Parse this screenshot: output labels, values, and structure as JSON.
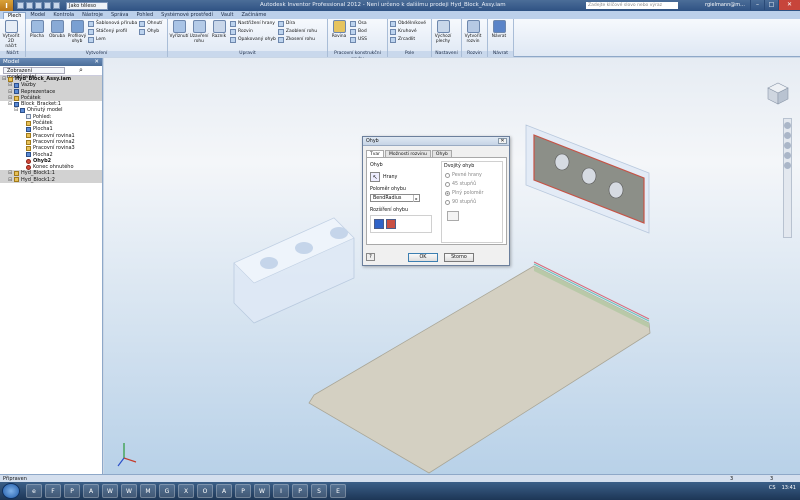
{
  "titlebar": {
    "qat_select": "Jako těleso",
    "title": "Autodesk Inventor Professional 2012 - Není určeno k dalšímu prodeji    Hyd_Block_Assy.iam",
    "search_placeholder": "Zadejte klíčové slovo nebo výraz",
    "user": "rgielmann@m..."
  },
  "tabs": [
    "Plech",
    "Model",
    "Kontrola",
    "Nástroje",
    "Správa",
    "Pohled",
    "Systémové prostředí",
    "Vault",
    "Začínáme"
  ],
  "ribbon": {
    "nacrt": {
      "label": "Náčrt",
      "btn": "Vytvořit 2D náčrt"
    },
    "vytvoreni": {
      "label": "Vytvoření",
      "big": [
        "Plocha",
        "Obruba",
        "Profilový ohyb"
      ],
      "small": [
        "Šablonová příruba",
        "Stáčený profil",
        "Lem",
        "Ohyb",
        "Ohnutí"
      ]
    },
    "upravit": {
      "label": "Upravit",
      "big": [
        "Vyříznutí",
        "Uzavření rohu",
        "Razník"
      ],
      "small": [
        "Nastřižení hrany",
        "Rozvin",
        "Opakovaný ohyb",
        "Díra",
        "Zaoblení rohu",
        "Zkosení rohu"
      ]
    },
    "pracovni": {
      "label": "Pracovní konstrukční prvky",
      "big": [
        "Rovina"
      ],
      "small": [
        "Osa",
        "Bod",
        "USS"
      ]
    },
    "pole": {
      "label": "Pole",
      "small": [
        "Obdélníkové",
        "Kruhové",
        "Zrcadlit"
      ]
    },
    "nastaveni": {
      "label": "Nastavení",
      "btn": "Výchozí plechy"
    },
    "rozvin": {
      "label": "Rozvin",
      "btn": "Vytvořit rozvin"
    },
    "navrat": {
      "label": "Návrat",
      "btn": "Návrat"
    }
  },
  "browser": {
    "title": "Model",
    "dropdown": "Zobrazení modelování",
    "nodes": [
      {
        "text": "Hyd_Block_Assy.iam",
        "bold": true,
        "gray": true,
        "indent": 0
      },
      {
        "text": "Vazby",
        "gray": true,
        "indent": 1
      },
      {
        "text": "Reprezentace",
        "gray": true,
        "indent": 1
      },
      {
        "text": "Počátek",
        "gray": true,
        "indent": 1
      },
      {
        "text": "Block_Bracket:1",
        "indent": 1
      },
      {
        "text": "Ohnutý model",
        "indent": 2
      },
      {
        "text": "Pohled:",
        "indent": 3
      },
      {
        "text": "Počátek",
        "indent": 3
      },
      {
        "text": "Plocha1",
        "indent": 3
      },
      {
        "text": "Pracovní rovina1",
        "indent": 3
      },
      {
        "text": "Pracovní rovina2",
        "indent": 3
      },
      {
        "text": "Pracovní rovina3",
        "indent": 3
      },
      {
        "text": "Plocha2",
        "indent": 3
      },
      {
        "text": "Ohyb2",
        "bold": true,
        "indent": 3
      },
      {
        "text": "Konec ohnutého",
        "indent": 3
      },
      {
        "text": "Hyd_Block1:1",
        "gray": true,
        "indent": 1
      },
      {
        "text": "Hyd_Block1:2",
        "gray": true,
        "indent": 1
      }
    ]
  },
  "dialog": {
    "title": "Ohyb",
    "tabs": [
      "Tvar",
      "Možnosti rozvinu",
      "Ohyb"
    ],
    "ohyb_label": "Ohyb",
    "hrany": "Hrany",
    "polomer_label": "Poloměr ohybu",
    "polomer_value": "BendRadius",
    "rozsireni_label": "Rozšíření ohybu",
    "dvojity_label": "Dvojitý ohyb",
    "options": [
      "Pevné hrany",
      "45 stupňů",
      "Plný poloměr",
      "90 stupňů"
    ],
    "ok": "OK",
    "cancel": "Storno"
  },
  "status": {
    "left": "Připraven",
    "n1": "3",
    "n2": "3"
  },
  "taskbar": {
    "apps": [
      "e",
      "F",
      "P",
      "A",
      "W",
      "W",
      "M",
      "G",
      "X",
      "O",
      "A",
      "P",
      "W",
      "I",
      "P",
      "S",
      "E"
    ],
    "lang": "CS",
    "time": "13:41"
  }
}
